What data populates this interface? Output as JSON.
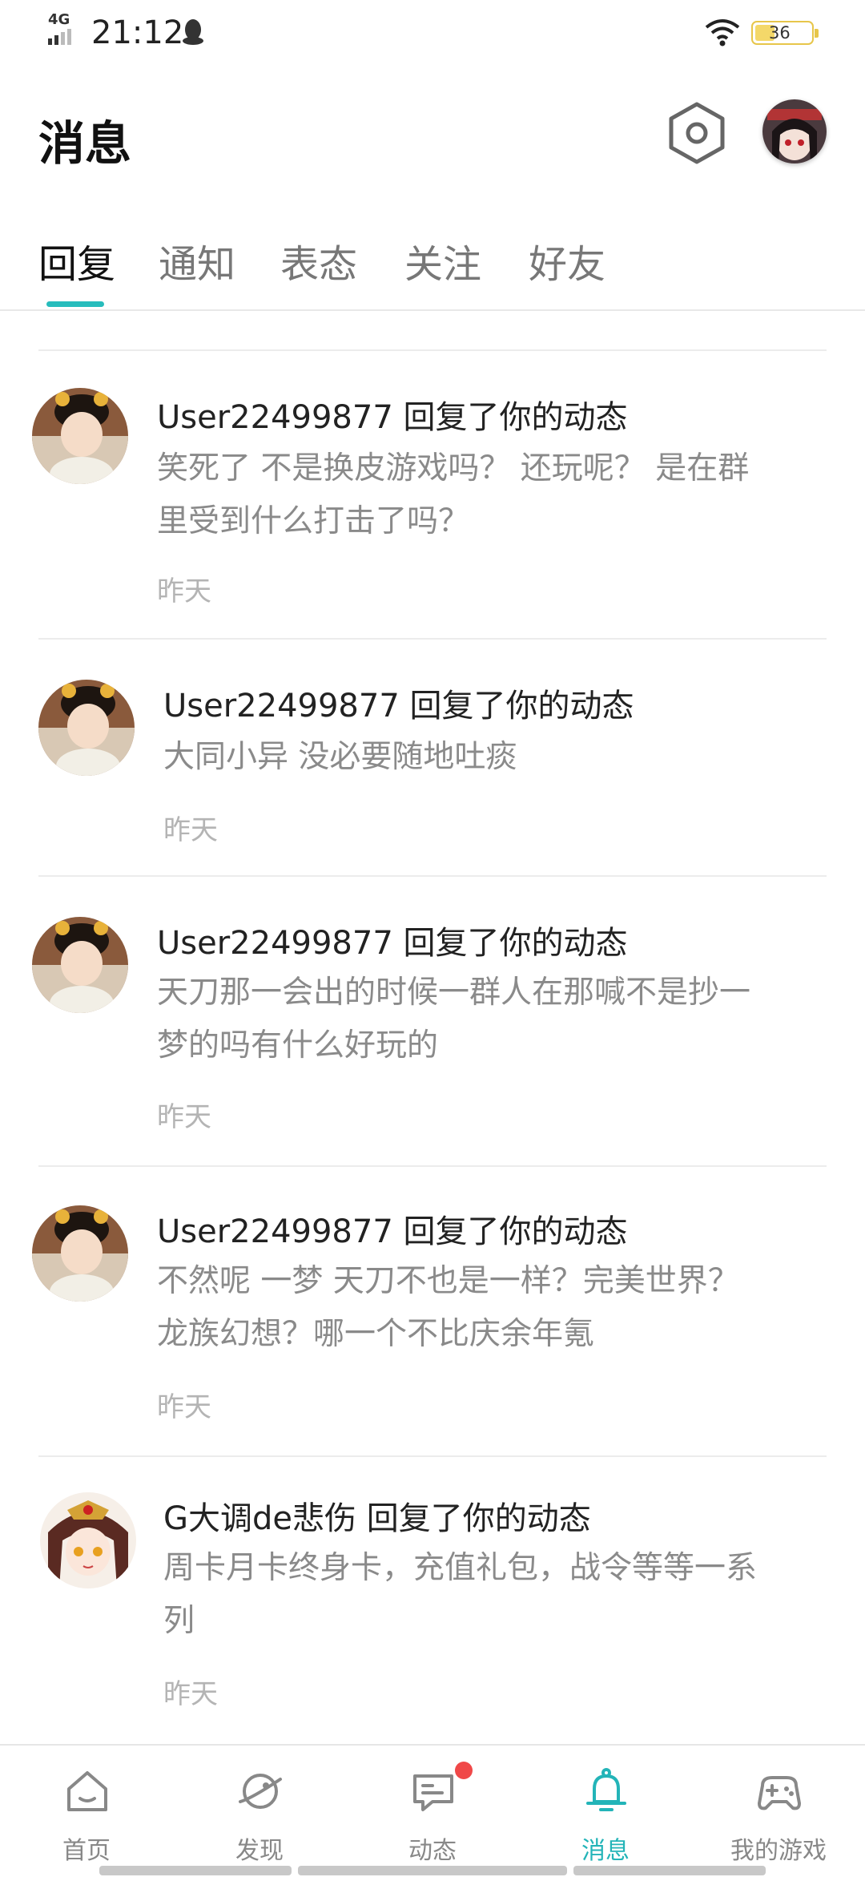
{
  "status_bar": {
    "network": "4G",
    "time": "21:12",
    "battery": "36",
    "battery_level": 0.36
  },
  "header": {
    "title": "消息"
  },
  "tabs": [
    {
      "label": "回复",
      "active": true
    },
    {
      "label": "通知",
      "active": false
    },
    {
      "label": "表态",
      "active": false
    },
    {
      "label": "关注",
      "active": false
    },
    {
      "label": "好友",
      "active": false
    }
  ],
  "messages": [
    {
      "title": "User22499877 回复了你的动态",
      "lines": [
        "笑死了 不是换皮游戏吗？ 还玩呢？ 是在群",
        "里受到什么打击了吗？"
      ],
      "time": "昨天"
    },
    {
      "title": "User22499877 回复了你的动态",
      "lines": [
        "大同小异  没必要随地吐痰"
      ],
      "time": "昨天"
    },
    {
      "title": "User22499877 回复了你的动态",
      "lines": [
        "天刀那一会出的时候一群人在那喊不是抄一",
        "梦的吗有什么好玩的"
      ],
      "time": "昨天"
    },
    {
      "title": "User22499877 回复了你的动态",
      "lines": [
        "不然呢  一梦 天刀不也是一样？完美世界？",
        "龙族幻想？哪一个不比庆余年氪"
      ],
      "time": "昨天"
    },
    {
      "title": "G大调de悲伤 回复了你的动态",
      "lines": [
        "周卡月卡终身卡，充值礼包，战令等等一系",
        "列"
      ],
      "time": "昨天"
    }
  ],
  "bottom_nav": [
    {
      "label": "首页",
      "icon": "home-icon",
      "active": false
    },
    {
      "label": "发现",
      "icon": "planet-icon",
      "active": false
    },
    {
      "label": "动态",
      "icon": "chat-icon",
      "active": false,
      "badge": true
    },
    {
      "label": "消息",
      "icon": "bell-icon",
      "active": true
    },
    {
      "label": "我的游戏",
      "icon": "gamepad-icon",
      "active": false
    }
  ],
  "colors": {
    "accent": "#23b4b8",
    "badge": "#f04848",
    "secondary_text": "#8a8a8a",
    "time_text": "#b4b4b4"
  }
}
